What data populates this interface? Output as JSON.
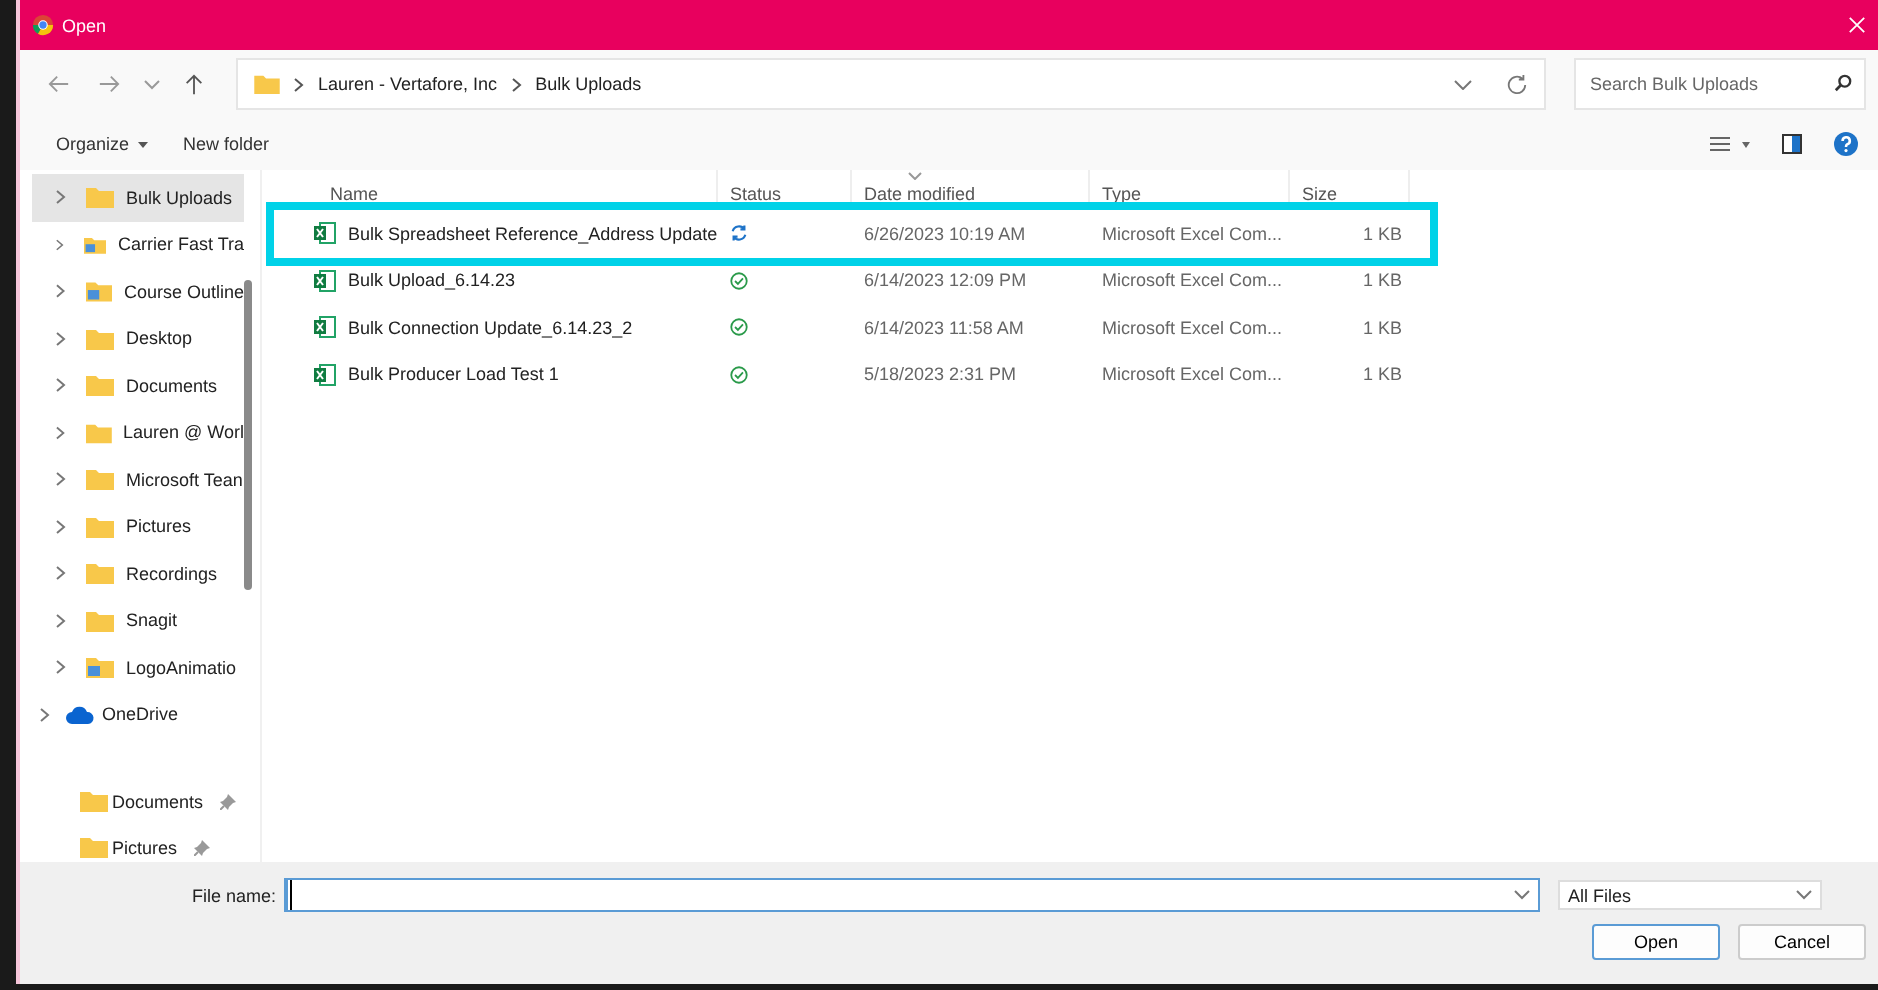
{
  "window": {
    "title": "Open"
  },
  "address": {
    "path": [
      "Lauren - Vertafore, Inc",
      "Bulk Uploads"
    ]
  },
  "search": {
    "placeholder": "Search Bulk Uploads"
  },
  "toolbar": {
    "organize": "Organize",
    "new_folder": "New folder"
  },
  "sidebar": {
    "items": [
      {
        "label": "Bulk Uploads",
        "kind": "folder",
        "selected": true
      },
      {
        "label": "Carrier Fast Tra",
        "kind": "shared-folder",
        "selected": false
      },
      {
        "label": "Course Outline",
        "kind": "shared-folder",
        "selected": false
      },
      {
        "label": "Desktop",
        "kind": "folder",
        "selected": false
      },
      {
        "label": "Documents",
        "kind": "folder",
        "selected": false
      },
      {
        "label": "Lauren @ Worl",
        "kind": "folder",
        "selected": false
      },
      {
        "label": "Microsoft Tean",
        "kind": "folder",
        "selected": false
      },
      {
        "label": "Pictures",
        "kind": "folder",
        "selected": false
      },
      {
        "label": "Recordings",
        "kind": "folder",
        "selected": false
      },
      {
        "label": "Snagit",
        "kind": "folder",
        "selected": false
      },
      {
        "label": "LogoAnimatio",
        "kind": "shared-folder",
        "selected": false
      },
      {
        "label": "OneDrive",
        "kind": "cloud",
        "selected": false
      }
    ],
    "quick_access": [
      {
        "label": "Documents",
        "pinned": true
      },
      {
        "label": "Pictures",
        "pinned": true
      }
    ]
  },
  "table": {
    "columns": [
      {
        "label": "Name",
        "sorted": false
      },
      {
        "label": "Status",
        "sorted": false
      },
      {
        "label": "Date modified",
        "sorted": true
      },
      {
        "label": "Type",
        "sorted": false
      },
      {
        "label": "Size",
        "sorted": false
      }
    ],
    "rows": [
      {
        "name": "Bulk Spreadsheet Reference_Address Update",
        "synced": false,
        "date": "6/26/2023 10:19 AM",
        "type": "Microsoft Excel Com...",
        "size": "1 KB",
        "highlighted": true
      },
      {
        "name": "Bulk Upload_6.14.23",
        "synced": true,
        "date": "6/14/2023 12:09 PM",
        "type": "Microsoft Excel Com...",
        "size": "1 KB",
        "highlighted": false
      },
      {
        "name": "Bulk Connection Update_6.14.23_2",
        "synced": true,
        "date": "6/14/2023 11:58 AM",
        "type": "Microsoft Excel Com...",
        "size": "1 KB",
        "highlighted": false
      },
      {
        "name": "Bulk Producer Load Test 1",
        "synced": true,
        "date": "5/18/2023 2:31 PM",
        "type": "Microsoft Excel Com...",
        "size": "1 KB",
        "highlighted": false
      }
    ]
  },
  "footer": {
    "file_name_label": "File name:",
    "file_type": "All Files",
    "buttons": [
      "Open",
      "Cancel"
    ]
  }
}
